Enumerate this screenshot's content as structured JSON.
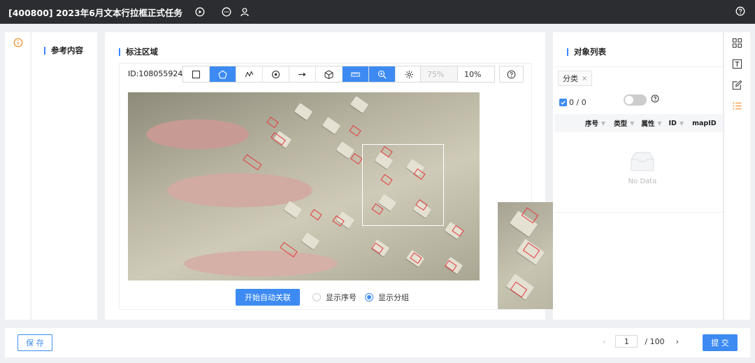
{
  "header": {
    "title": "[400800] 2023年6月文本行拉框正式任务"
  },
  "reference": {
    "title": "参考内容"
  },
  "annotation": {
    "title": "标注区域",
    "id_label": "ID:1080559244",
    "opacity_value": "75%",
    "zoom_value": "10%",
    "auto_link_label": "开始自动关联",
    "show_index_label": "显示序号",
    "show_group_label": "显示分组",
    "show_group_selected": true
  },
  "objects": {
    "title": "对象列表",
    "filter_tag": "分类",
    "count": "0 / 0",
    "columns": [
      "序号",
      "类型",
      "属性",
      "ID",
      "mapID"
    ],
    "empty_text": "No Data"
  },
  "footer": {
    "save_label": "保 存",
    "page_current": "1",
    "page_total": "/ 100",
    "submit_label": "提 交"
  },
  "colors": {
    "accent": "#3d8bf2",
    "warning": "#f08a24",
    "box": "#e4393c"
  }
}
